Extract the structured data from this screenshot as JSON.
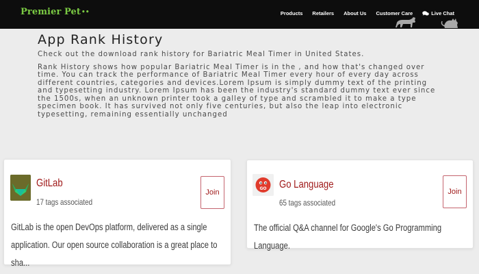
{
  "nav": {
    "brand": "Premier Pet",
    "brand_mark": "••",
    "links": [
      "Products",
      "Retailers",
      "About Us",
      "Customer Care"
    ],
    "chat_label": "Live Chat"
  },
  "page": {
    "title": "App Rank History",
    "intro": "Check out the download rank history for Bariatric Meal Timer in United States.",
    "description": "Rank History shows how popular Bariatric Meal Timer is in the , and how that's changed over time. You can track the performance of Bariatric Meal Timer every hour of every day across different countries, categories and devices.Lorem Ipsum is simply dummy text of the printing and typesetting industry. Lorem Ipsum has been the industry's standard dummy text ever since the 1500s, when an unknown printer took a galley of type and scrambled it to make a type specimen book. It has survived not only five centuries, but also the leap into electronic typesetting, remaining essentially unchanged"
  },
  "cards": [
    {
      "name": "GitLab",
      "tags": "17 tags associated",
      "join_label": "Join",
      "description": "GitLab is the open DevOps platform, delivered as a single application. Our open source collaboration is a great place to sha..."
    },
    {
      "name": "Go Language",
      "tags": "65 tags associated",
      "join_label": "Join",
      "description": "The official Q&A channel for Google's Go Programming Language."
    }
  ],
  "colors": {
    "nav_bg": "#0d0d0d",
    "brand": "#7ac943",
    "card_title": "#a01a1a",
    "join_border": "#c4646e"
  },
  "icons": {
    "chat": "chat-bubbles-icon",
    "gitlab": "gitlab-fox-icon",
    "go": "go-gopher-icon",
    "pets": "cat-and-dog-silhouette-icon"
  }
}
